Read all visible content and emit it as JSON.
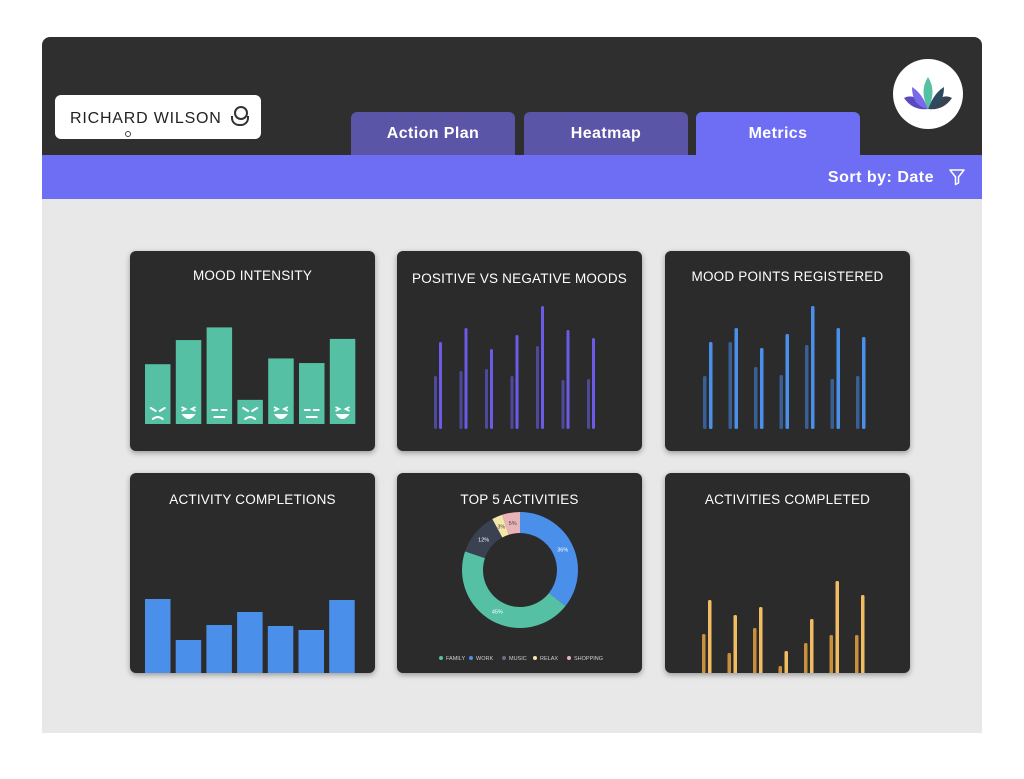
{
  "user": {
    "name": "RICHARD WILSON"
  },
  "tabs": [
    {
      "label": "Action Plan"
    },
    {
      "label": "Heatmap"
    },
    {
      "label": "Metrics",
      "active": true
    }
  ],
  "sort": {
    "label": "Sort by: Date"
  },
  "colors": {
    "accent": "#6e6ef5",
    "tab_inactive": "#5a55a6",
    "teal": "#55c0a3",
    "purple": "#6b5be6",
    "blue": "#4a8fea",
    "gold": "#f2bd62"
  },
  "cards": {
    "mood_intensity": {
      "title": "MOOD INTENSITY"
    },
    "pos_neg": {
      "title": "POSITIVE VS NEGATIVE MOODS"
    },
    "mood_points": {
      "title": "MOOD POINTS REGISTERED"
    },
    "activity_completions": {
      "title": "ACTIVITY COMPLETIONS"
    },
    "top5": {
      "title": "TOP 5 ACTIVITIES"
    },
    "activities_completed": {
      "title": "ACTIVITIES COMPLETED"
    }
  },
  "chart_data": [
    {
      "id": "mood_intensity",
      "type": "bar",
      "title": "MOOD INTENSITY",
      "values": [
        52,
        73,
        84,
        21,
        57,
        53,
        74
      ],
      "faces": [
        "angry",
        "laugh",
        "neutral",
        "angry",
        "laugh",
        "neutral",
        "laugh"
      ],
      "ylim": [
        0,
        100
      ],
      "color": "#55c0a3"
    },
    {
      "id": "pos_neg",
      "type": "bar",
      "title": "POSITIVE VS NEGATIVE MOODS",
      "series": [
        {
          "values": [
            53,
            58,
            60,
            53,
            83,
            49,
            50
          ]
        },
        {
          "values": [
            87,
            101,
            80,
            94,
            123,
            99,
            91
          ]
        }
      ],
      "ylim": [
        0,
        130
      ],
      "colors": [
        "#4d4a99",
        "#6b5be6"
      ]
    },
    {
      "id": "mood_points",
      "type": "bar",
      "title": "MOOD POINTS REGISTERED",
      "series": [
        {
          "values": [
            53,
            87,
            62,
            54,
            84,
            50,
            53
          ]
        },
        {
          "values": [
            87,
            101,
            81,
            95,
            123,
            101,
            92
          ]
        }
      ],
      "ylim": [
        0,
        130
      ],
      "colors": [
        "#3a5f95",
        "#4a8fea"
      ]
    },
    {
      "id": "activity_completions",
      "type": "bar",
      "title": "ACTIVITY COMPLETIONS",
      "values": [
        84,
        43,
        58,
        71,
        57,
        53,
        83
      ],
      "ylim": [
        0,
        100
      ],
      "color": "#4a8fea"
    },
    {
      "id": "top5",
      "type": "pie",
      "title": "TOP 5 ACTIVITIES",
      "labels": [
        "FAMILY",
        "WORK",
        "MUSIC",
        "RELAX",
        "SHOPPING"
      ],
      "values": [
        45,
        36,
        12,
        3,
        5
      ],
      "display_labels": [
        "45%",
        "36%",
        "12%",
        "3%",
        "5%"
      ],
      "colors": [
        "#55c0a3",
        "#4a8fea",
        "#3a4151",
        "#f4e7a8",
        "#e8b4b8"
      ],
      "legend": "bottom"
    },
    {
      "id": "activities_completed",
      "type": "bar",
      "title": "ACTIVITIES COMPLETED",
      "series": [
        {
          "values": [
            53,
            34,
            59,
            21,
            44,
            52,
            52
          ]
        },
        {
          "values": [
            87,
            72,
            80,
            36,
            68,
            106,
            92
          ]
        }
      ],
      "ylim": [
        0,
        120
      ],
      "colors": [
        "#c98f3d",
        "#f2bd62"
      ]
    }
  ]
}
